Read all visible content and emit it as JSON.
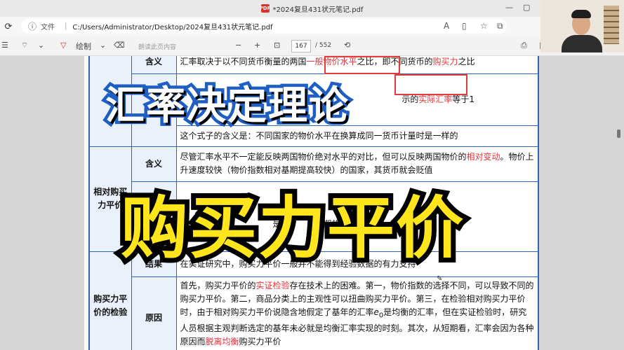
{
  "window": {
    "title": "*2024复旦431状元笔记.pdf",
    "pdf_badge": "PDF"
  },
  "address": {
    "file_label": "文件",
    "path": "C:/Users/Administrator/Desktop/2024复旦431状元笔记.pdf"
  },
  "toolbar": {
    "draw_label": "绘制",
    "erase_placeholder": "朗读此页内容",
    "page_current": "167",
    "page_total": "/ 552"
  },
  "overlay": {
    "title_top": "汇率决定理论",
    "title_main": "购买力平价"
  },
  "table": {
    "row0": {
      "sub": "含义",
      "text_a": "汇率取决于以不同货币衡量的两国",
      "hl_a": "一般物价水平",
      "text_b": "之比，即不同货币的",
      "hl_b": "购买力",
      "text_c": "之比"
    },
    "row0b": {
      "text_a": "示的",
      "hl_a": "实际汇率",
      "text_b": "等于1"
    },
    "row0c": {
      "text": "这个式子的含义是：不同国家的物价水平在换算成同一货币计量时是一样的"
    },
    "row1": {
      "cat": "相对购买力平价",
      "sub": "含义",
      "text_a": "尽管汇率水平不一定能反映两国物价绝对水平的对比，但可以反映两国物价的",
      "hl_a": "相对变动",
      "text_b": "。物价上升速度较快（物价指数相对基期提高较快）的国家，其货币就会贬值"
    },
    "row1b": {
      "text_a": "中",
      "text_b": "是",
      "text_c": "期的物",
      "text_d": "的变动；",
      "text_e": "e",
      "text_f": "是"
    },
    "row1c": {
      "text": "算"
    },
    "row2": {
      "cat": "购买力平价的检验",
      "sub": "结果",
      "text": "在实证研究中，购买力平价一般并不能得到经验数据的有力支持"
    },
    "row3": {
      "sub": "原因",
      "text_a": "首先，购买力平价的",
      "hl_a": "实证检验",
      "text_b": "存在技术上的困难。第一，物价指数的选择不同，可以导致不同的购买力平价。第二，商品分类上的主观性可以扭曲购买力平价。第三，在检验相对购买力平价时，由于相对购买力平价说隐含地假定了基年的汇率",
      "text_c": "e",
      "text_d": "是均衡的汇率，但在实证检验时，研究人员根据主观判断选定的基年未必就是均衡汇率实现的时刻。其次，从短期看，汇率会因为各种原因而",
      "hl_b": "脱离均衡",
      "text_e": "购买力平价"
    }
  },
  "colors": {
    "accent": "#2b66b8",
    "highlight": "#e0343c",
    "title_blue": "#1f5fc4",
    "title_yellow": "#ffe51c"
  }
}
